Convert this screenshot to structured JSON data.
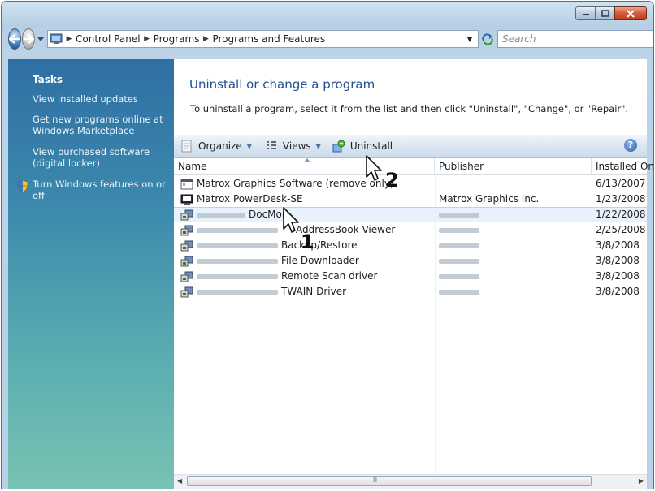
{
  "window": {
    "caption_buttons": [
      "minimize-icon",
      "maximize-icon",
      "close-icon"
    ]
  },
  "nav": {
    "breadcrumb": [
      "Control Panel",
      "Programs",
      "Programs and Features"
    ],
    "search_placeholder": "Search"
  },
  "sidebar": {
    "heading": "Tasks",
    "items": [
      "View installed updates",
      "Get new programs online at Windows Marketplace",
      "View purchased software (digital locker)",
      "Turn Windows features on or off"
    ]
  },
  "main": {
    "title": "Uninstall or change a program",
    "instruction": "To uninstall a program, select it from the list and then click \"Uninstall\", \"Change\", or \"Repair\"."
  },
  "toolbar": {
    "organize": "Organize",
    "views": "Views",
    "uninstall": "Uninstall",
    "help": "?"
  },
  "columns": {
    "name": "Name",
    "publisher": "Publisher",
    "installed_on": "Installed On"
  },
  "programs": [
    {
      "name": "Matrox Graphics Software (remove only)",
      "publisher": "",
      "installed_on": "6/13/2007"
    },
    {
      "name": "Matrox PowerDesk-SE",
      "publisher": "Matrox Graphics Inc.",
      "installed_on": "1/23/2008"
    },
    {
      "name": "DocMon",
      "publisher": "",
      "installed_on": "1/22/2008"
    },
    {
      "name": "AddressBook Viewer",
      "publisher": "",
      "installed_on": "2/25/2008"
    },
    {
      "name": "Backup/Restore",
      "publisher": "",
      "installed_on": "3/8/2008"
    },
    {
      "name": "File Downloader",
      "publisher": "",
      "installed_on": "3/8/2008"
    },
    {
      "name": "Remote Scan driver",
      "publisher": "",
      "installed_on": "3/8/2008"
    },
    {
      "name": "TWAIN Driver",
      "publisher": "",
      "installed_on": "3/8/2008"
    }
  ],
  "scrollbar": {
    "grip": "III"
  },
  "callouts": [
    "1",
    "2"
  ]
}
